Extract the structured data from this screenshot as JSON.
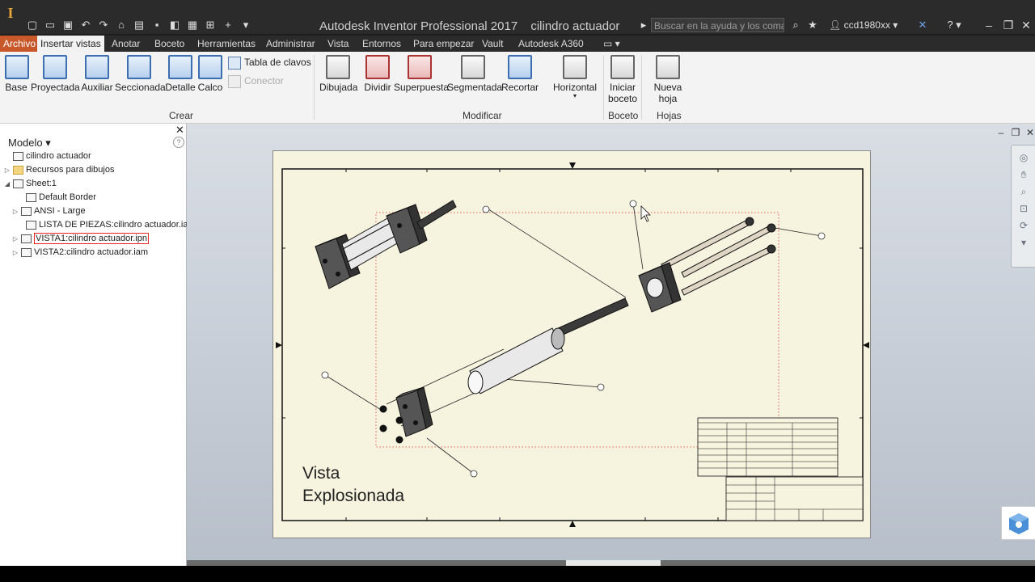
{
  "title": {
    "app": "Autodesk Inventor Professional 2017",
    "document": "cilindro actuador",
    "search_placeholder": "Buscar en la ayuda y los comand",
    "user": "ccd1980xx"
  },
  "menu": {
    "file": "Archivo",
    "tabs": [
      "Insertar vistas",
      "Anotar",
      "Boceto",
      "Herramientas",
      "Administrar",
      "Vista",
      "Entornos",
      "Para empezar",
      "Vault",
      "Autodesk A360"
    ]
  },
  "ribbon": {
    "crear": {
      "label": "Crear",
      "buttons": [
        "Base",
        "Proyectada",
        "Auxiliar",
        "Seccionada",
        "Detalle",
        "Calco"
      ],
      "small": [
        "Tabla de clavos",
        "Conector"
      ]
    },
    "modificar": {
      "label": "Modificar",
      "buttons": [
        "Dibujada",
        "Dividir",
        "Superpuesta",
        "Segmentada",
        "Recortar",
        "Horizontal"
      ]
    },
    "boceto": {
      "label": "Boceto",
      "button_line1": "Iniciar",
      "button_line2": "boceto"
    },
    "hojas": {
      "label": "Hojas",
      "button": "Nueva hoja"
    }
  },
  "browser": {
    "title": "Modelo",
    "items": [
      {
        "label": "cilindro actuador",
        "level": 0,
        "expander": "",
        "selected": false
      },
      {
        "label": "Recursos para dibujos",
        "level": 0,
        "expander": "right",
        "selected": false
      },
      {
        "label": "Sheet:1",
        "level": 0,
        "expander": "down",
        "selected": false
      },
      {
        "label": "Default Border",
        "level": 1,
        "expander": "",
        "selected": false
      },
      {
        "label": "ANSI - Large",
        "level": 1,
        "expander": "right",
        "selected": false
      },
      {
        "label": "LISTA DE PIEZAS:cilindro actuador.iam",
        "level": 1,
        "expander": "",
        "selected": false
      },
      {
        "label": "VISTA1:cilindro actuador.ipn",
        "level": 1,
        "expander": "right",
        "selected": true
      },
      {
        "label": "VISTA2:cilindro actuador.iam",
        "level": 1,
        "expander": "right",
        "selected": false
      }
    ]
  },
  "drawing": {
    "caption_line1": "Vista",
    "caption_line2": "Explosionada"
  },
  "colors": {
    "file_tab": "#c8582a",
    "sheet": "#f6f3de",
    "selection": "#e22222"
  }
}
